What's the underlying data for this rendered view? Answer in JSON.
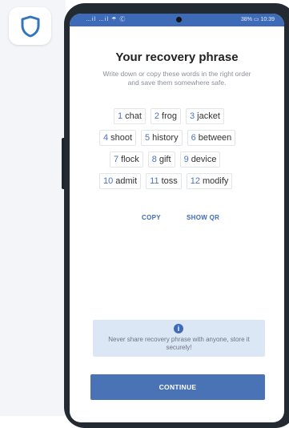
{
  "app": {
    "logo_icon": "shield-icon"
  },
  "status_bar": {
    "left": "…il …il ☂ Ⓒ",
    "right": "38% ▭ 10:39"
  },
  "title": "Your recovery phrase",
  "subtitle": "Write down or copy these words in the right order and save them somewhere safe.",
  "words": [
    {
      "num": "1",
      "word": "chat"
    },
    {
      "num": "2",
      "word": "frog"
    },
    {
      "num": "3",
      "word": "jacket"
    },
    {
      "num": "4",
      "word": "shoot"
    },
    {
      "num": "5",
      "word": "history"
    },
    {
      "num": "6",
      "word": "between"
    },
    {
      "num": "7",
      "word": "flock"
    },
    {
      "num": "8",
      "word": "gift"
    },
    {
      "num": "9",
      "word": "device"
    },
    {
      "num": "10",
      "word": "admit"
    },
    {
      "num": "11",
      "word": "toss"
    },
    {
      "num": "12",
      "word": "modify"
    }
  ],
  "actions": {
    "copy_label": "COPY",
    "show_qr_label": "SHOW QR"
  },
  "warning": {
    "icon": "info-icon",
    "text": "Never share recovery phrase with anyone, store it securely!"
  },
  "continue_label": "CONTINUE",
  "colors": {
    "accent": "#3d6bb8",
    "button": "#4a73b5",
    "warning_bg": "#dce7f6"
  }
}
